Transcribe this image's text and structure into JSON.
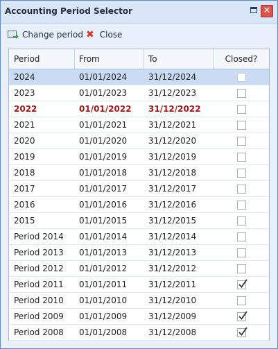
{
  "window": {
    "title": "Accounting Period Selector"
  },
  "toolbar": {
    "change_label": "Change period",
    "close_label": "Close"
  },
  "columns": {
    "period": "Period",
    "from": "From",
    "to": "To",
    "closed": "Closed?"
  },
  "rows": [
    {
      "period": "2024",
      "from": "01/01/2024",
      "to": "31/12/2024",
      "closed": false,
      "selected": true,
      "current": false
    },
    {
      "period": "2023",
      "from": "01/01/2023",
      "to": "31/12/2023",
      "closed": false,
      "selected": false,
      "current": false
    },
    {
      "period": "2022",
      "from": "01/01/2022",
      "to": "31/12/2022",
      "closed": false,
      "selected": false,
      "current": true
    },
    {
      "period": "2021",
      "from": "01/01/2021",
      "to": "31/12/2021",
      "closed": false,
      "selected": false,
      "current": false
    },
    {
      "period": "2020",
      "from": "01/01/2020",
      "to": "31/12/2020",
      "closed": false,
      "selected": false,
      "current": false
    },
    {
      "period": "2019",
      "from": "01/01/2019",
      "to": "31/12/2019",
      "closed": false,
      "selected": false,
      "current": false
    },
    {
      "period": "2018",
      "from": "01/01/2018",
      "to": "31/12/2018",
      "closed": false,
      "selected": false,
      "current": false
    },
    {
      "period": "2017",
      "from": "01/01/2017",
      "to": "31/12/2017",
      "closed": false,
      "selected": false,
      "current": false
    },
    {
      "period": "2016",
      "from": "01/01/2016",
      "to": "31/12/2016",
      "closed": false,
      "selected": false,
      "current": false
    },
    {
      "period": "2015",
      "from": "01/01/2015",
      "to": "31/12/2015",
      "closed": false,
      "selected": false,
      "current": false
    },
    {
      "period": "Period 2014",
      "from": "01/01/2014",
      "to": "31/12/2014",
      "closed": false,
      "selected": false,
      "current": false
    },
    {
      "period": "Period 2013",
      "from": "01/01/2013",
      "to": "31/12/2013",
      "closed": false,
      "selected": false,
      "current": false
    },
    {
      "period": "Period 2012",
      "from": "01/01/2012",
      "to": "31/12/2012",
      "closed": false,
      "selected": false,
      "current": false
    },
    {
      "period": "Period 2011",
      "from": "01/01/2011",
      "to": "31/12/2011",
      "closed": true,
      "selected": false,
      "current": false
    },
    {
      "period": "Period 2010",
      "from": "01/01/2010",
      "to": "31/12/2010",
      "closed": false,
      "selected": false,
      "current": false
    },
    {
      "period": "Period 2009",
      "from": "01/01/2009",
      "to": "31/12/2009",
      "closed": true,
      "selected": false,
      "current": false
    },
    {
      "period": "Period 2008",
      "from": "01/01/2008",
      "to": "31/12/2008",
      "closed": true,
      "selected": false,
      "current": false
    }
  ],
  "colors": {
    "selected_row": "#c9dcf3",
    "current_period_text": "#9b1b1b",
    "title_bar": "#d8e6f8",
    "close_button": "#d9534f"
  },
  "icons": {
    "change": "change-period-icon",
    "close": "close-x-icon",
    "maximize": "maximize-icon",
    "window_close": "window-close-icon"
  }
}
